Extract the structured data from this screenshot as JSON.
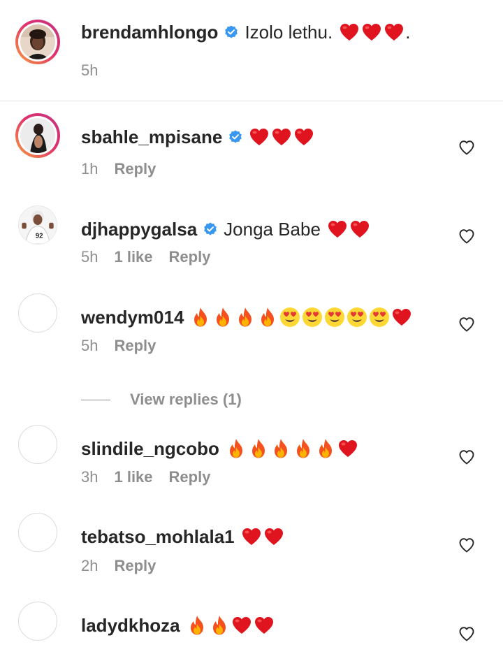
{
  "caption": {
    "username": "brendamhlongo",
    "verified": true,
    "text": "Izolo lethu.",
    "emojis": [
      "heart",
      "heart",
      "heart"
    ],
    "suffix": ".",
    "time": "5h"
  },
  "comments": [
    {
      "username": "sbahle_mpisane",
      "verified": true,
      "text": "",
      "emojis": [
        "heart",
        "heart",
        "heart"
      ],
      "time": "1h",
      "likes": "",
      "reply_label": "Reply"
    },
    {
      "username": "djhappygalsa",
      "verified": true,
      "text": "Jonga Babe",
      "emojis": [
        "heart",
        "heart"
      ],
      "time": "5h",
      "likes": "1 like",
      "reply_label": "Reply"
    },
    {
      "username": "wendym014",
      "verified": false,
      "text": "",
      "emojis": [
        "fire",
        "fire",
        "fire",
        "fire",
        "heart-eyes",
        "heart-eyes",
        "heart-eyes",
        "heart-eyes",
        "heart-eyes",
        "heart"
      ],
      "time": "5h",
      "likes": "",
      "reply_label": "Reply",
      "view_replies": "View replies (1)"
    },
    {
      "username": "slindile_ngcobo",
      "verified": false,
      "text": "",
      "emojis": [
        "fire",
        "fire",
        "fire",
        "fire",
        "fire",
        "heart"
      ],
      "time": "3h",
      "likes": "1 like",
      "reply_label": "Reply"
    },
    {
      "username": "tebatso_mohlala1",
      "verified": false,
      "text": "",
      "emojis": [
        "heart",
        "heart"
      ],
      "time": "2h",
      "likes": "",
      "reply_label": "Reply"
    },
    {
      "username": "ladydkhoza",
      "verified": false,
      "text": "",
      "emojis": [
        "fire",
        "fire",
        "heart",
        "heart"
      ],
      "time": "",
      "likes": "",
      "reply_label": ""
    }
  ],
  "icons": {
    "verified_color": "#3897f0",
    "like_icon": "heart-outline-icon"
  }
}
